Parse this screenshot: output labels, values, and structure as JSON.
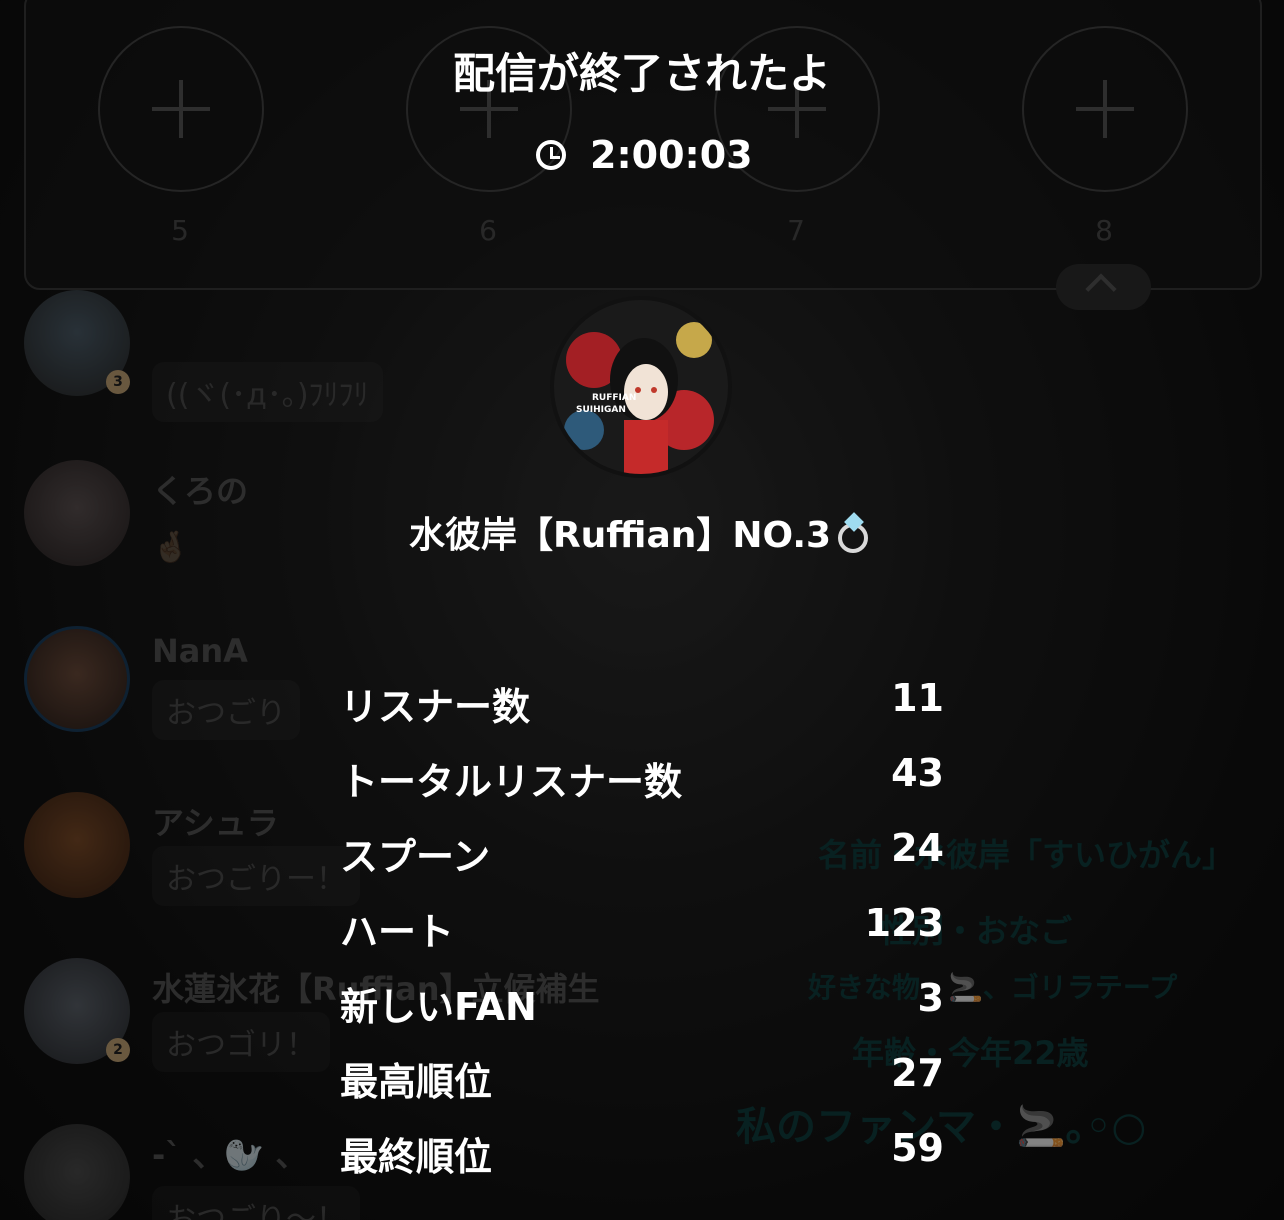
{
  "header": {
    "title": "配信が終了されたよ",
    "duration": "2:00:03"
  },
  "slots": [
    "5",
    "6",
    "7",
    "8"
  ],
  "chat": [
    {
      "name": "",
      "message": "((ヾ(･д･｡)ﾌﾘﾌﾘ",
      "badge": "3"
    },
    {
      "name": "くろの",
      "message": "🤞🏼",
      "badge": ""
    },
    {
      "name": "NanA",
      "message": "おつごり",
      "badge": ""
    },
    {
      "name": "アシュラ",
      "message": "おつごりー！",
      "badge": ""
    },
    {
      "name": "水蓮氷花【Ruffian】立候補生",
      "message": "おつゴリ！",
      "badge": "2"
    },
    {
      "name": "-` 、🦭 、",
      "message": "おつごり〜！",
      "badge": ""
    }
  ],
  "profile": {
    "name": "水彼岸【Ruffian】NO.3",
    "avatar_text": "RUFFIAN SUIHIGAN"
  },
  "stats": [
    {
      "label": "リスナー数",
      "value": "11"
    },
    {
      "label": "トータルリスナー数",
      "value": "43"
    },
    {
      "label": "スプーン",
      "value": "24"
    },
    {
      "label": "ハート",
      "value": "123"
    },
    {
      "label": "新しいFAN",
      "value": "3"
    },
    {
      "label": "最高順位",
      "value": "27"
    },
    {
      "label": "最終順位",
      "value": "59"
    }
  ],
  "background_text": {
    "line1": "名前・水彼岸「すいひがん」",
    "line2": "性別・おなご",
    "line3": "好きな物・🚬、ゴリラテープ",
    "line4": "年齢・今年22歳",
    "line5": "私のファンマ・🚬｡◦○"
  },
  "colors": {
    "bg": "#111111",
    "text": "#ffffff",
    "muted": "#525252"
  }
}
